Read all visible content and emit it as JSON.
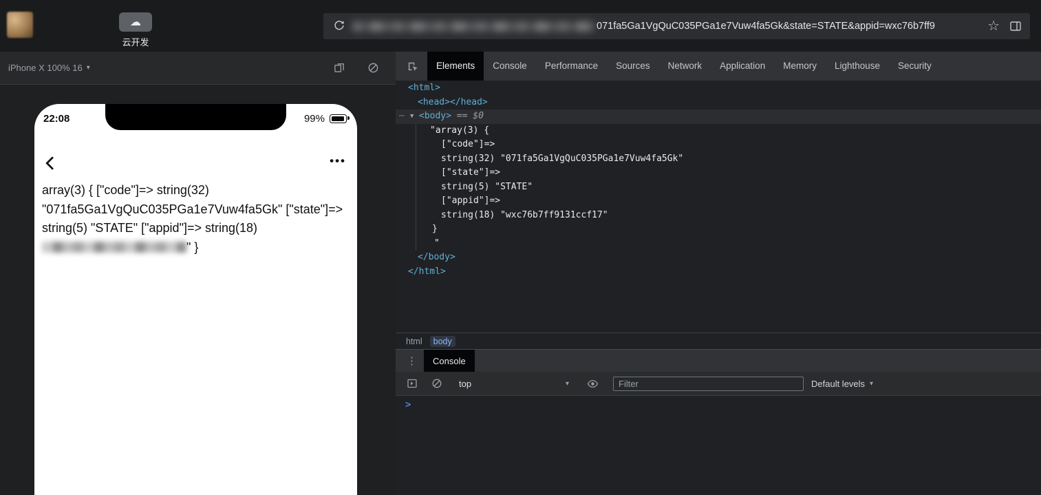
{
  "icons": {
    "caret_down": "▾",
    "dots_vertical": "⋮",
    "star": "☆",
    "cloud": "☁",
    "prompt": ">"
  },
  "top_bar": {
    "cloud_tool": {
      "label": "云开发"
    },
    "url": {
      "visible_text": "071fa5Ga1VgQuC035PGa1e7Vuw4fa5Gk&state=STATE&appid=wxc76b7ff9"
    }
  },
  "device_panel": {
    "toolbar_label": "iPhone X 100% 16",
    "phone": {
      "status_time": "22:08",
      "battery_percent": "99%",
      "more_dots": "•••",
      "body_text_before": "array(3) { [\"code\"]=> string(32) \"071fa5Ga1VgQuC035PGa1e7Vuw4fa5Gk\" [\"state\"]=> string(5) \"STATE\" [\"appid\"]=> string(18) ",
      "body_text_after": "\" }"
    }
  },
  "devtools": {
    "tabs": [
      {
        "label": "Elements",
        "active": true
      },
      {
        "label": "Console",
        "active": false
      },
      {
        "label": "Performance",
        "active": false
      },
      {
        "label": "Sources",
        "active": false
      },
      {
        "label": "Network",
        "active": false
      },
      {
        "label": "Application",
        "active": false
      },
      {
        "label": "Memory",
        "active": false
      },
      {
        "label": "Lighthouse",
        "active": false
      },
      {
        "label": "Security",
        "active": false
      }
    ],
    "elements_tree": {
      "lines": [
        {
          "ind": "0",
          "parts": [
            {
              "c": "tag",
              "t": "<html>"
            }
          ]
        },
        {
          "ind": "1",
          "parts": [
            {
              "c": "tag",
              "t": "<head></head>"
            }
          ]
        },
        {
          "ind": "body",
          "selected": true,
          "gutter": "⋯",
          "arrow": "▼",
          "parts": [
            {
              "c": "tag",
              "t": "<body>"
            },
            {
              "c": "meta",
              "t": " == $0"
            }
          ]
        },
        {
          "ind": "2",
          "parts": [
            {
              "c": "text",
              "t": "\"array(3) {"
            }
          ]
        },
        {
          "ind": "3",
          "parts": [
            {
              "c": "text",
              "t": "[\"code\"]=>"
            }
          ]
        },
        {
          "ind": "3",
          "parts": [
            {
              "c": "text",
              "t": "string(32) \"071fa5Ga1VgQuC035PGa1e7Vuw4fa5Gk\""
            }
          ]
        },
        {
          "ind": "3",
          "parts": [
            {
              "c": "text",
              "t": "[\"state\"]=>"
            }
          ]
        },
        {
          "ind": "3",
          "parts": [
            {
              "c": "text",
              "t": "string(5) \"STATE\""
            }
          ]
        },
        {
          "ind": "3",
          "parts": [
            {
              "c": "text",
              "t": "[\"appid\"]=>"
            }
          ]
        },
        {
          "ind": "3",
          "parts": [
            {
              "c": "text",
              "t": "string(18) \"wxc76b7ff9131ccf17\""
            }
          ]
        },
        {
          "ind": "4",
          "parts": [
            {
              "c": "text",
              "t": "}"
            }
          ]
        },
        {
          "ind": "5",
          "parts": [
            {
              "c": "text",
              "t": "\""
            }
          ]
        },
        {
          "ind": "1",
          "parts": [
            {
              "c": "tag",
              "t": "</body>"
            }
          ]
        },
        {
          "ind": "0",
          "parts": [
            {
              "c": "tag",
              "t": "</html>"
            }
          ]
        }
      ]
    },
    "breadcrumbs": [
      {
        "label": "html",
        "selected": false
      },
      {
        "label": "body",
        "selected": true
      }
    ],
    "drawer": {
      "console_tab_label": "Console",
      "context_selector": "top",
      "filter_placeholder": "Filter",
      "levels_label": "Default levels"
    }
  },
  "colors": {
    "tag_blue": "#5db0d7",
    "crumb_blue": "#8ab4f8",
    "prompt_blue": "#4e7fe8"
  }
}
